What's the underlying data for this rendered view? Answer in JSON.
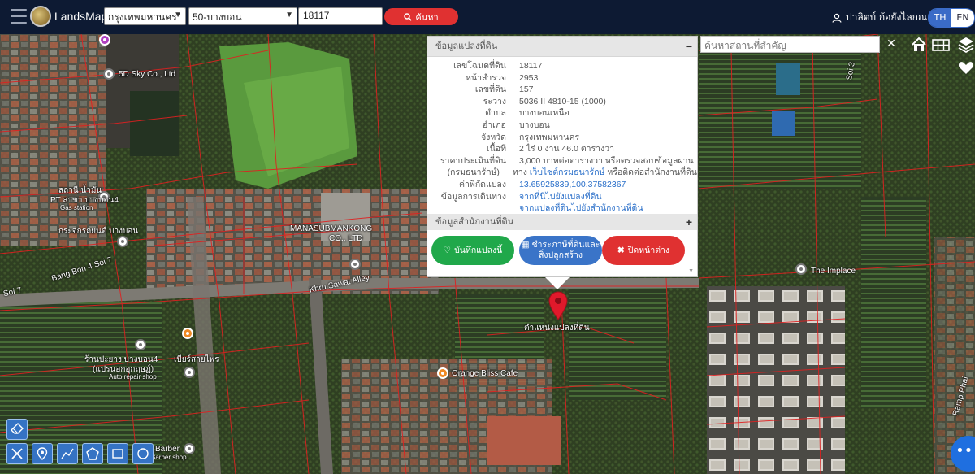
{
  "app": {
    "brand": "LandsMaps",
    "province_select": "กรุงเทพมหานคร",
    "district_select": "50-บางบอน",
    "parcel_no_input": "18117",
    "search_button": "ค้นหา",
    "user_name": "ปาลิตบ์ ก้อยังไลกณ",
    "lang_th": "TH",
    "lang_en": "EN"
  },
  "place_search": {
    "placeholder": "ค้นหาสถานที่สำคัญ",
    "clear_label": "✕"
  },
  "popup": {
    "title": "ข้อมูลแปลงที่ดิน",
    "collapse_symbol": "−",
    "rows": [
      {
        "key": "เลขโฉนดที่ดิน",
        "value": "18117"
      },
      {
        "key": "หน้าสำรวจ",
        "value": "2953"
      },
      {
        "key": "เลขที่ดิน",
        "value": "157"
      },
      {
        "key": "ระวาง",
        "value": "5036 II 4810-15 (1000)"
      },
      {
        "key": "ตำบล",
        "value": "บางบอนเหนือ"
      },
      {
        "key": "อำเภอ",
        "value": "บางบอน"
      },
      {
        "key": "จังหวัด",
        "value": "กรุงเทพมหานคร"
      },
      {
        "key": "เนื้อที่",
        "value": "2 ไร่ 0 งาน 46.0 ตารางวา"
      },
      {
        "key": "ราคาประเมินที่ดิน",
        "value": "3,000 บาทต่อตารางวา หรือตรวจสอบข้อมูลผ่าน"
      },
      {
        "key": "(กรมธนารักษ์)",
        "value_pre": "ทาง ",
        "value_link": "เว็บไซต์กรมธนารักษ์",
        "value_post": " หรือติดต่อสำนักงานที่ดิน"
      },
      {
        "key": "ค่าพิกัดแปลง",
        "value": "13.65925839,100.37582367"
      },
      {
        "key": "ข้อมูลการเดินทาง",
        "value": "จากที่นี่ไปยังแปลงที่ดิน"
      },
      {
        "key": "",
        "value": "จากแปลงที่ดินไปยังสำนักงานที่ดิน"
      }
    ],
    "office_section": "ข้อมูลสำนักงานที่ดิน",
    "expand_symbol": "+",
    "btn_save": "บันทึกแปลงนี้",
    "btn_tax_line1": "ชำระภาษีที่ดินและ",
    "btn_tax_line2": "สิ่งปลูกสร้าง",
    "btn_close": "ปิดหน้าต่าง"
  },
  "map_labels": {
    "l1": "5D Sky Co., Ltd",
    "l2": "สถานี น้ำมัน",
    "l3": "PT สาขา บางบอน4",
    "l4": "Gas station",
    "l5": "กระจกรถยนต์ บางบอน",
    "l6": "MANASUBMANKONG",
    "l7": "CO., LTD",
    "l8": "Khru Sawat Alley",
    "l9": "Bang Bon 4 Soi 7",
    "l10": "Soi 7",
    "l11": "ร้านปะยาง บางบอน4",
    "l12": "(แปรนอกอุกฤษฏ์)",
    "l13": "Auto repair shop",
    "l14": "เบียร์สายไพร",
    "l15": "Orange Bliss Cafe",
    "l16": "ตำแหน่งแปลงที่ดิน",
    "l17": "The Implace",
    "l18": "Barber",
    "l19": "Barber shop",
    "l20": "Ramp Phai",
    "l21": "Soi 3"
  },
  "colors": {
    "topbar": "#0d1a33",
    "search_btn": "#e03131",
    "save_btn": "#20a84a",
    "tax_btn": "#3a74c8",
    "close_btn": "#e03131",
    "parcel_lines": "#e02020",
    "tools": "#3573c4"
  }
}
